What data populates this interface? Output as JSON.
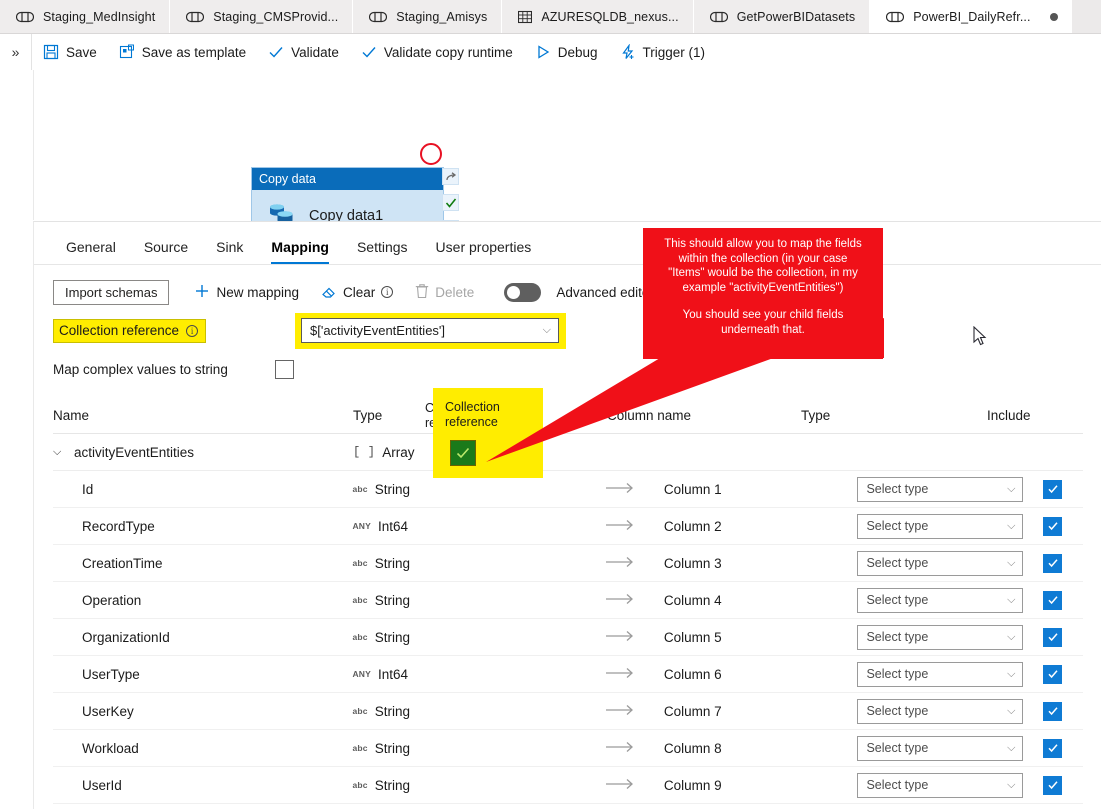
{
  "tabs": [
    {
      "label": "Staging_MedInsight",
      "icon": "pipeline-icon",
      "active": false,
      "dirty": false
    },
    {
      "label": "Staging_CMSProvid...",
      "icon": "pipeline-icon",
      "active": false,
      "dirty": false
    },
    {
      "label": "Staging_Amisys",
      "icon": "pipeline-icon",
      "active": false,
      "dirty": false
    },
    {
      "label": "AZURESQLDB_nexus...",
      "icon": "table-icon",
      "active": false,
      "dirty": false
    },
    {
      "label": "GetPowerBIDatasets",
      "icon": "pipeline-icon",
      "active": false,
      "dirty": false
    },
    {
      "label": "PowerBI_DailyRefr...",
      "icon": "pipeline-icon",
      "active": true,
      "dirty": true
    }
  ],
  "commandbar": {
    "overflow": "»",
    "items": [
      {
        "label": "Save",
        "icon": "save-icon"
      },
      {
        "label": "Save as template",
        "icon": "save-as-template-icon"
      },
      {
        "label": "Validate",
        "icon": "checkmark-icon"
      },
      {
        "label": "Validate copy runtime",
        "icon": "checkmark-icon"
      },
      {
        "label": "Debug",
        "icon": "play-icon"
      },
      {
        "label": "Trigger (1)",
        "icon": "trigger-icon"
      }
    ]
  },
  "canvas": {
    "activity": {
      "header": "Copy data",
      "title": "Copy data1",
      "icon": "copy-data-icon",
      "footer_icons": [
        "delete-icon",
        "code-icon",
        "clone-icon",
        "add-output-icon"
      ]
    },
    "connectors": [
      "skip-icon",
      "success-icon",
      "failure-icon",
      "completion-icon"
    ]
  },
  "panel": {
    "tabs": [
      {
        "label": "General",
        "active": false
      },
      {
        "label": "Source",
        "active": false
      },
      {
        "label": "Sink",
        "active": false
      },
      {
        "label": "Mapping",
        "active": true
      },
      {
        "label": "Settings",
        "active": false
      },
      {
        "label": "User properties",
        "active": false
      }
    ],
    "toolbar": {
      "import_schemas": "Import schemas",
      "new_mapping": "New mapping",
      "clear": "Clear",
      "delete": "Delete",
      "advanced_editor": "Advanced editor",
      "advanced_editor_on": false
    },
    "collection_reference": {
      "label": "Collection reference",
      "value": "$['activityEventEntities']",
      "highlighted": true
    },
    "map_complex": {
      "label": "Map complex values to string",
      "checked": false
    }
  },
  "mapping_table": {
    "headers": {
      "name": "Name",
      "type": "Type",
      "collection_reference": "Collection\nreference",
      "collection_reference_line1": "Collection",
      "collection_reference_line2": "reference",
      "column_name": "Column name",
      "type2": "Type",
      "include": "Include"
    },
    "select_type_placeholder": "Select type",
    "rows": [
      {
        "name": "activityEventEntities",
        "type": "Array",
        "type_badge": "[ ]",
        "root": true,
        "collection_ref_checked": true,
        "column_name": "",
        "sink_type": "",
        "include": false
      },
      {
        "name": "Id",
        "type": "String",
        "type_badge": "abc",
        "root": false,
        "collection_ref_checked": false,
        "column_name": "Column 1",
        "sink_type": "Select type",
        "include": true
      },
      {
        "name": "RecordType",
        "type": "Int64",
        "type_badge": "ANY",
        "root": false,
        "collection_ref_checked": false,
        "column_name": "Column 2",
        "sink_type": "Select type",
        "include": true
      },
      {
        "name": "CreationTime",
        "type": "String",
        "type_badge": "abc",
        "root": false,
        "collection_ref_checked": false,
        "column_name": "Column 3",
        "sink_type": "Select type",
        "include": true
      },
      {
        "name": "Operation",
        "type": "String",
        "type_badge": "abc",
        "root": false,
        "collection_ref_checked": false,
        "column_name": "Column 4",
        "sink_type": "Select type",
        "include": true
      },
      {
        "name": "OrganizationId",
        "type": "String",
        "type_badge": "abc",
        "root": false,
        "collection_ref_checked": false,
        "column_name": "Column 5",
        "sink_type": "Select type",
        "include": true
      },
      {
        "name": "UserType",
        "type": "Int64",
        "type_badge": "ANY",
        "root": false,
        "collection_ref_checked": false,
        "column_name": "Column 6",
        "sink_type": "Select type",
        "include": true
      },
      {
        "name": "UserKey",
        "type": "String",
        "type_badge": "abc",
        "root": false,
        "collection_ref_checked": false,
        "column_name": "Column 7",
        "sink_type": "Select type",
        "include": true
      },
      {
        "name": "Workload",
        "type": "String",
        "type_badge": "abc",
        "root": false,
        "collection_ref_checked": false,
        "column_name": "Column 8",
        "sink_type": "Select type",
        "include": true
      },
      {
        "name": "UserId",
        "type": "String",
        "type_badge": "abc",
        "root": false,
        "collection_ref_checked": false,
        "column_name": "Column 9",
        "sink_type": "Select type",
        "include": true
      }
    ]
  },
  "annotation": {
    "line1": "This should allow you to map the fields",
    "line2": "within the collection (in your case",
    "line3": "\"Items\" would be the collection, in my",
    "line4": "example \"activityEventEntities\")",
    "line5": "You should see your child fields",
    "line6": "underneath that."
  },
  "colors": {
    "accent_blue": "#0078d4",
    "annotation_red": "#f01018",
    "highlight_yellow": "#ffed00",
    "checkbox_blue": "#0f7bd4",
    "checkbox_green": "#1a7a1a",
    "node_header_blue": "#0a6cba"
  }
}
